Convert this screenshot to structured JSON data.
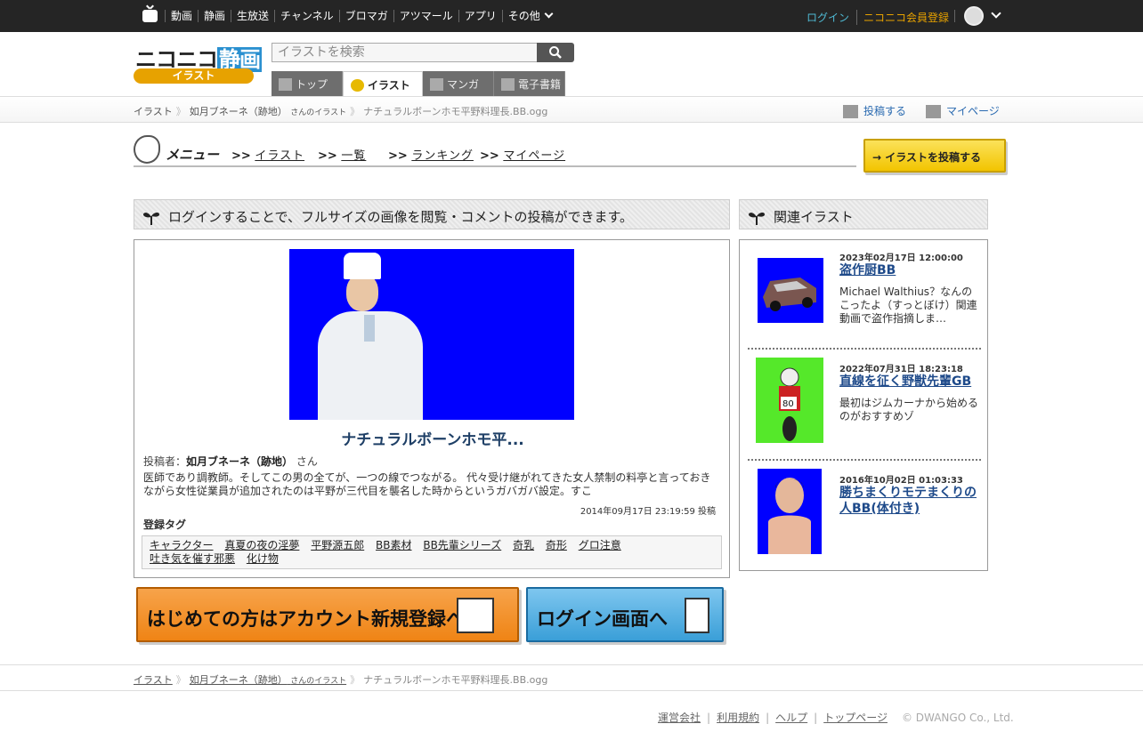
{
  "topnav": {
    "items": [
      "動画",
      "静画",
      "生放送",
      "チャンネル",
      "ブロマガ",
      "アツマール",
      "アプリ",
      "その他"
    ],
    "login": "ログイン",
    "register": "ニコニコ会員登録"
  },
  "header": {
    "logo_main": "ニコニコ",
    "logo_accent": "静画",
    "logo_sub": "イラスト",
    "search_placeholder": "イラストを検索",
    "tabs": [
      "トップ",
      "イラスト",
      "マンガ",
      "電子書籍"
    ],
    "active_tab": "イラスト"
  },
  "breadcrumb": {
    "root": "イラスト",
    "user": "如月ブネーネ（跡地）",
    "user_suffix": "さんのイラスト",
    "current": "ナチュラルボーンホモ平野料理長.BB.ogg",
    "post": "投稿する",
    "mypage": "マイページ"
  },
  "menu": {
    "title": "メニュー",
    "items": [
      ">>",
      "イラスト",
      ">>",
      "一覧",
      ">>",
      "ランキング",
      ">>",
      "マイページ"
    ],
    "upload_button": "→ イラストを投稿する"
  },
  "main": {
    "notice": "ログインすることで、フルサイズの画像を閲覧・コメントの投稿ができます。",
    "title": "ナチュラルボーンホモ平...",
    "author_label": "投稿者：",
    "author": "如月ブネーネ（跡地）",
    "author_suffix": "さん",
    "description": "医師であり調教師。そしてこの男の全てが、一つの線でつながる。 代々受け継がれてきた女人禁制の料亭と言っておきながら女性従業員が追加されたのは平野が三代目を襲名した時からというガバガバ設定。すこ",
    "date": "2014年09月17日 23:19:59 投稿",
    "tags_label": "登録タグ",
    "tags": [
      "キャラクター",
      "真夏の夜の淫夢",
      "平野源五郎",
      "BB素材",
      "BB先輩シリーズ",
      "奇乳",
      "奇形",
      "グロ注意",
      "吐き気を催す邪悪",
      "化け物"
    ]
  },
  "side": {
    "title": "関連イラスト",
    "items": [
      {
        "date": "2023年02月17日 12:00:00",
        "title": "盗作厨BB",
        "summary": "Michael Walthius？なんのこったよ（すっとぼけ）関連動画で盗作指摘しま…"
      },
      {
        "date": "2022年07月31日 18:23:18",
        "title": "直線を征く野獣先輩GB",
        "summary": "最初はジムカーナから始めるのがおすすめゾ"
      },
      {
        "date": "2016年10月02日 01:03:33",
        "title": "勝ちまくりモテまくりの人BB(体付き)",
        "summary": ""
      }
    ]
  },
  "banners": {
    "register": "はじめての方はアカウント新規登録へ",
    "login": "ログイン画面へ"
  },
  "footer": {
    "links": [
      "運営会社",
      "利用規約",
      "ヘルプ",
      "トップページ"
    ],
    "copyright": "© DWANGO Co., Ltd."
  },
  "colors": {
    "topbar": "#252525",
    "login": "#4fb9d3",
    "register": "#e7a200",
    "link": "#1e4a8a",
    "image_bg": "#0000ff"
  }
}
